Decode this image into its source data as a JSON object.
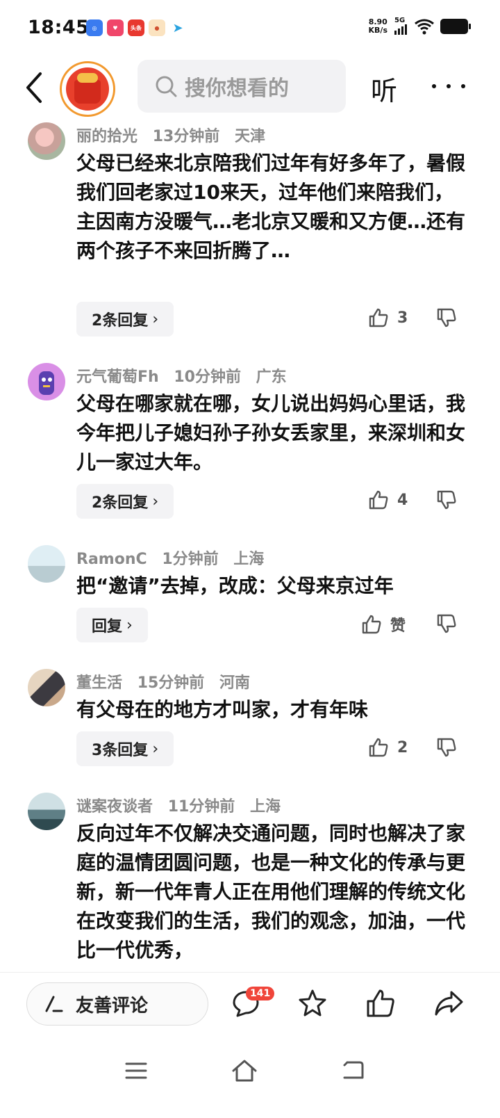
{
  "status_bar": {
    "time": "18:45",
    "net_speed_value": "8.90",
    "net_speed_unit": "KB/s",
    "network_type": "5G",
    "app_icons": [
      "browser-app-icon",
      "shopping-app-icon",
      "toutiao-app-icon",
      "game-app-icon",
      "telegram-app-icon"
    ],
    "app_icon_labels": [
      "",
      "",
      "头条",
      "",
      ""
    ]
  },
  "nav": {
    "search_placeholder": "搜你想看的",
    "listen_label": "听"
  },
  "comments": [
    {
      "user": "丽的拾光",
      "time": "13分钟前",
      "location": "天津",
      "text": "父母已经来北京陪我们过年有好多年了，暑假我们回老家过10来天，过年他们来陪我们，主因南方没暖气…老北京又暖和又方便…还有两个孩子不来回折腾了…",
      "reply_label": "2条回复",
      "likes": "3"
    },
    {
      "user": "元气葡萄Fh",
      "time": "10分钟前",
      "location": "广东",
      "text": "父母在哪家就在哪，女儿说出妈妈心里话，我今年把儿子媳妇孙子孙女丢家里，来深圳和女儿一家过大年。",
      "reply_label": "2条回复",
      "likes": "4"
    },
    {
      "user": "RamonC",
      "time": "1分钟前",
      "location": "上海",
      "text": "把“邀请”去掉，改成：父母来京过年",
      "reply_label": "回复",
      "likes": "赞"
    },
    {
      "user": "董生活",
      "time": "15分钟前",
      "location": "河南",
      "text": "有父母在的地方才叫家，才有年味",
      "reply_label": "3条回复",
      "likes": "2"
    },
    {
      "user": "谜案夜谈者",
      "time": "11分钟前",
      "location": "上海",
      "text": "反向过年不仅解决交通问题，同时也解决了家庭的温情团圆问题，也是一种文化的传承与更新，新一代年青人正在用他们理解的传统文化在改变我们的生活，我们的观念，加油，一代比一代优秀，",
      "reply_label": "",
      "likes": ""
    }
  ],
  "bottom_bar": {
    "friendly_comment_label": "友善评论",
    "comment_count": "141"
  },
  "colors": {
    "accent_orange": "#f2992e",
    "badge_red": "#f0453a",
    "meta_gray": "#8a8a8a"
  }
}
